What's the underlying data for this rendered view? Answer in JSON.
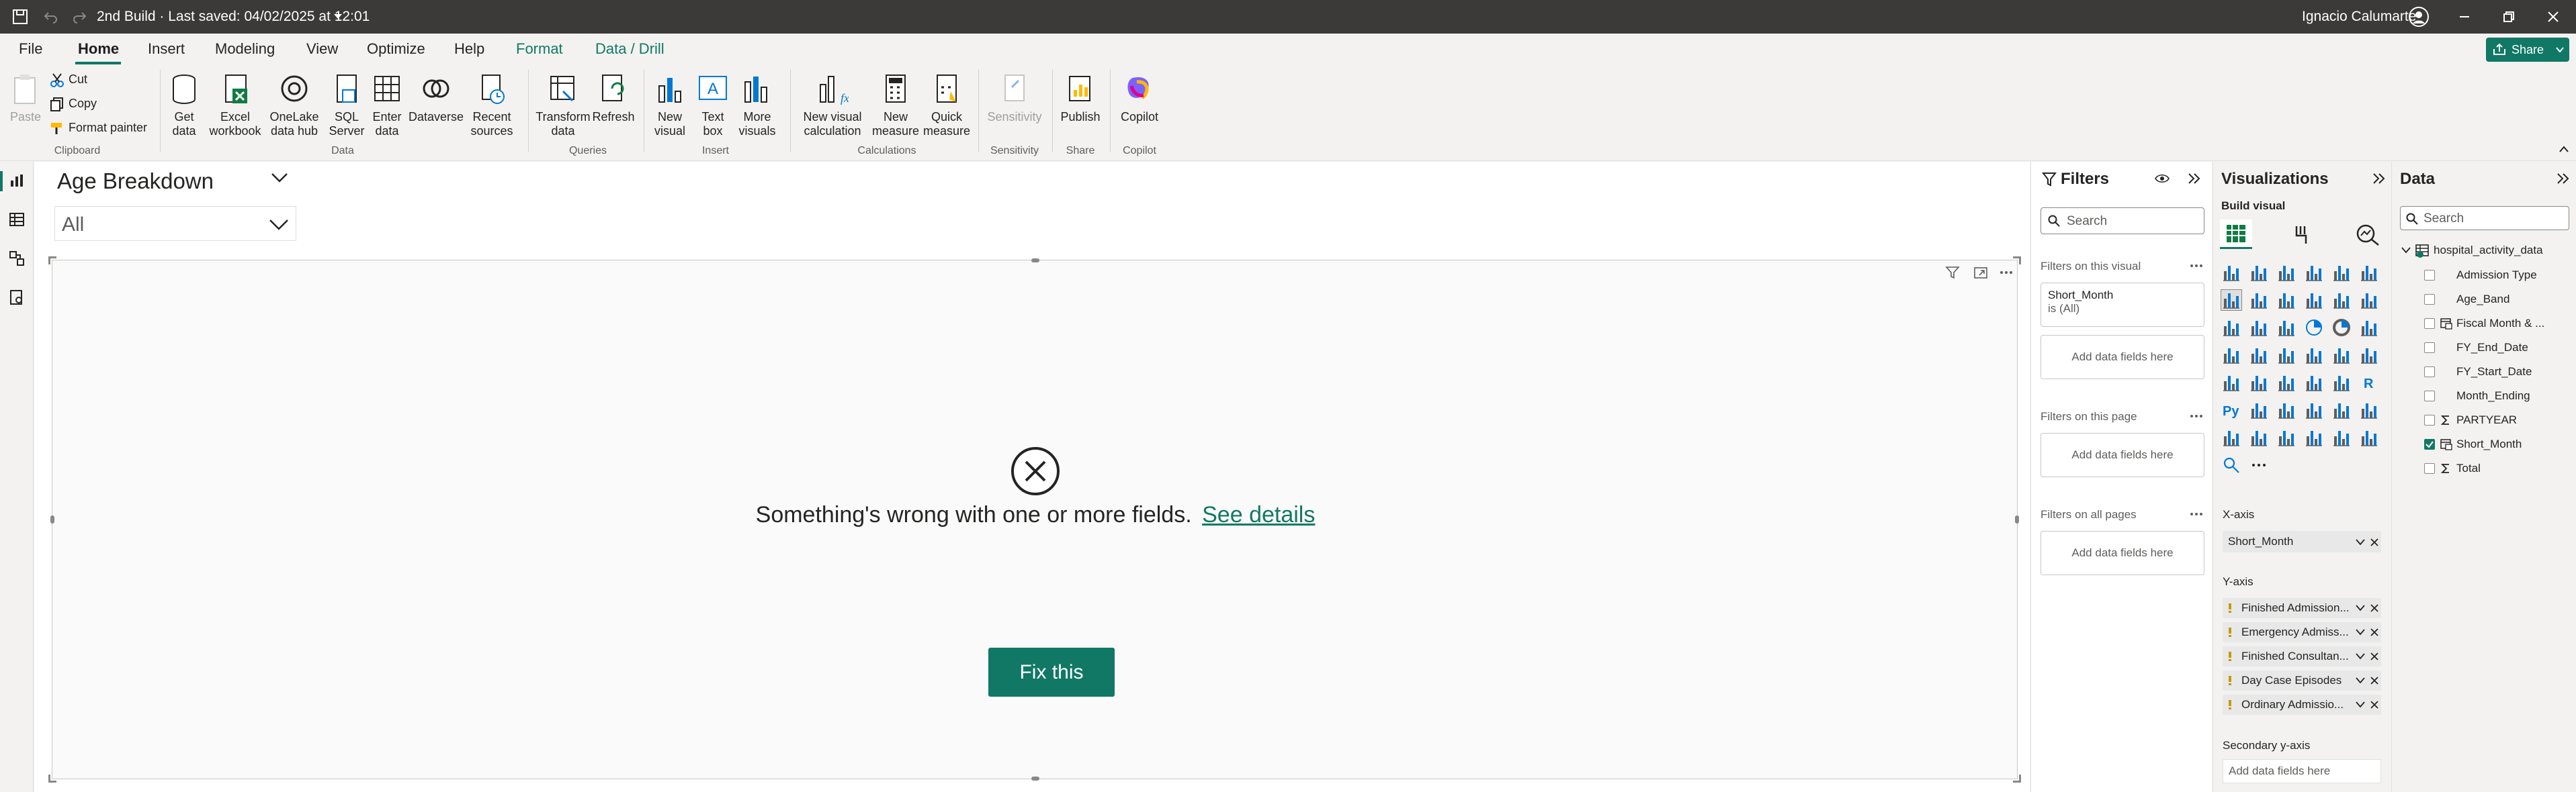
{
  "titlebar": {
    "doc_title": "2nd Build · Last saved: 04/02/2025 at 12:01",
    "user": "Ignacio Calumarte",
    "share_label": "Share"
  },
  "menu": {
    "items": [
      "File",
      "Home",
      "Insert",
      "Modeling",
      "View",
      "Optimize",
      "Help",
      "Format",
      "Data / Drill"
    ]
  },
  "ribbon": {
    "clipboard": {
      "paste": "Paste",
      "cut": "Cut",
      "copy": "Copy",
      "format_painter": "Format painter",
      "group": "Clipboard"
    },
    "data": {
      "get_data": [
        "Get",
        "data"
      ],
      "excel": [
        "Excel",
        "workbook"
      ],
      "onelake": [
        "OneLake",
        "data hub"
      ],
      "sql": [
        "SQL",
        "Server"
      ],
      "enter": [
        "Enter",
        "data"
      ],
      "dataverse": [
        "Dataverse"
      ],
      "recent": [
        "Recent",
        "sources"
      ],
      "group": "Data"
    },
    "queries": {
      "transform": [
        "Transform",
        "data"
      ],
      "refresh": [
        "Refresh"
      ],
      "group": "Queries"
    },
    "insert": {
      "new_visual": [
        "New",
        "visual"
      ],
      "text_box": [
        "Text",
        "box"
      ],
      "more_visuals": [
        "More",
        "visuals"
      ],
      "group": "Insert"
    },
    "calculations": {
      "new_visual_calc": [
        "New visual",
        "calculation"
      ],
      "new_measure": [
        "New",
        "measure"
      ],
      "quick_measure": [
        "Quick",
        "measure"
      ],
      "group": "Calculations"
    },
    "sensitivity": {
      "sensitivity": [
        "Sensitivity"
      ],
      "group": "Sensitivity"
    },
    "share": {
      "publish": [
        "Publish"
      ],
      "group": "Share"
    },
    "copilot": {
      "copilot": [
        "Copilot"
      ],
      "group": "Copilot"
    }
  },
  "canvas": {
    "slicer_title": "Age Breakdown",
    "slicer_value": "All",
    "error_message": "Something's wrong with one or more fields.",
    "see_details": "See details",
    "fix_button": "Fix this"
  },
  "filters": {
    "title": "Filters",
    "search_placeholder": "Search",
    "on_visual": "Filters on this visual",
    "filter_card_field": "Short_Month",
    "filter_card_value": "is (All)",
    "add_fields": "Add data fields here",
    "on_page": "Filters on this page",
    "on_all_pages": "Filters on all pages"
  },
  "visualizations": {
    "title": "Visualizations",
    "build_visual": "Build visual",
    "x_axis_label": "X-axis",
    "x_axis_field": "Short_Month",
    "y_axis_label": "Y-axis",
    "y_axis_fields": [
      "Finished Admission...",
      "Emergency Admiss...",
      "Finished Consultan...",
      "Day Case Episodes",
      "Ordinary Admissio..."
    ],
    "secondary_y_label": "Secondary y-axis",
    "add_fields": "Add data fields here"
  },
  "data": {
    "title": "Data",
    "search_placeholder": "Search",
    "table_name": "hospital_activity_data",
    "fields": [
      {
        "name": "Admission Type",
        "checked": false,
        "icon": ""
      },
      {
        "name": "Age_Band",
        "checked": false,
        "icon": ""
      },
      {
        "name": "Fiscal Month & ...",
        "checked": false,
        "icon": "hierarchy"
      },
      {
        "name": "FY_End_Date",
        "checked": false,
        "icon": ""
      },
      {
        "name": "FY_Start_Date",
        "checked": false,
        "icon": ""
      },
      {
        "name": "Month_Ending",
        "checked": false,
        "icon": ""
      },
      {
        "name": "PARTYEAR",
        "checked": false,
        "icon": "sigma"
      },
      {
        "name": "Short_Month",
        "checked": true,
        "icon": "hierarchy"
      },
      {
        "name": "Total",
        "checked": false,
        "icon": "sigma"
      }
    ]
  },
  "colors": {
    "accent": "#117865",
    "titlebar": "#3b3a39"
  }
}
